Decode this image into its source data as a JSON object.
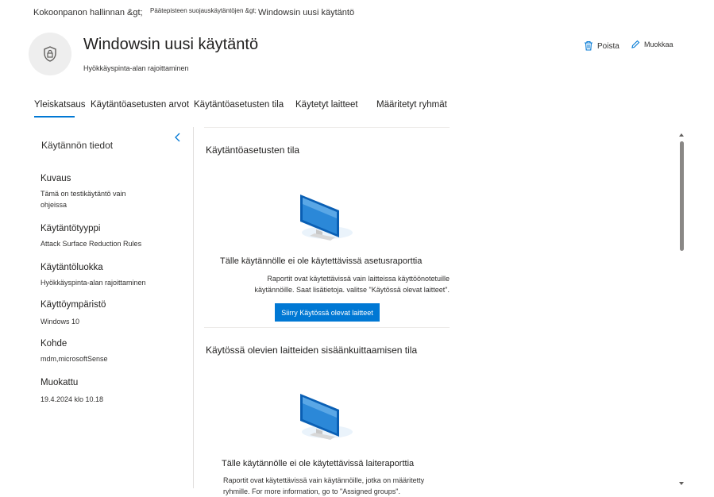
{
  "breadcrumb": {
    "item1": "Kokoonpanon hallinnan &gt;",
    "item2": "Päätepisteen suojauskäytäntöjen &gt;",
    "item3": "Windowsin uusi käytäntö"
  },
  "header": {
    "icon": "shield-lock-icon",
    "title": "Windowsin uusi käytäntö",
    "subtitle": "Hyökkäyspinta-alan rajoittaminen",
    "delete_label": "Poista",
    "edit_label": "Muokkaa"
  },
  "tabs": [
    {
      "label": "Yleiskatsaus",
      "selected": true
    },
    {
      "label": "Käytäntöasetusten arvot",
      "selected": false
    },
    {
      "label": "Käytäntöasetusten tila",
      "selected": false
    },
    {
      "label": "Käytetyt laitteet",
      "selected": false
    },
    {
      "label": "Määritetyt ryhmät",
      "selected": false
    }
  ],
  "details": {
    "title": "Käytännön tiedot",
    "fields": [
      {
        "label": "Kuvaus",
        "value": "Tämä on testikäytäntö vain ohjeissa"
      },
      {
        "label": "Käytäntötyyppi",
        "value": "Attack Surface Reduction Rules"
      },
      {
        "label": "Käytäntöluokka",
        "value": "Hyökkäyspinta-alan rajoittaminen"
      },
      {
        "label": "Käyttöympäristö",
        "value": "Windows 10"
      },
      {
        "label": "Kohde",
        "value": "mdm,microsoftSense"
      },
      {
        "label": "Muokattu",
        "value": "19.4.2024 klo 10.18"
      }
    ]
  },
  "sections": {
    "settings_status": {
      "title": "Käytäntöasetusten tila",
      "empty_title": "Tälle käytännölle ei ole käytettävissä asetusraporttia",
      "empty_desc_line1": "Raportit ovat käytettävissä vain laitteissa käyttöönotetuille",
      "empty_desc_line2": "käytännöille. Saat lisätietoja. valitse \"Käytössä olevat laitteet\".",
      "button_label": "Siirry Käytössä olevat laitteet"
    },
    "checkin_status": {
      "title": "Käytössä olevien laitteiden sisäänkuittaamisen tila",
      "empty_title": "Tälle käytännölle ei ole käytettävissä laiteraporttia",
      "empty_desc_line1": "Raportit ovat käytettävissä vain käytännöille, jotka on määritetty",
      "empty_desc_line2": "ryhmille. For more information, go to \"Assigned groups\"."
    }
  },
  "colors": {
    "accent": "#0078d4",
    "text": "#201f1e",
    "divider": "#e1dfdd"
  }
}
